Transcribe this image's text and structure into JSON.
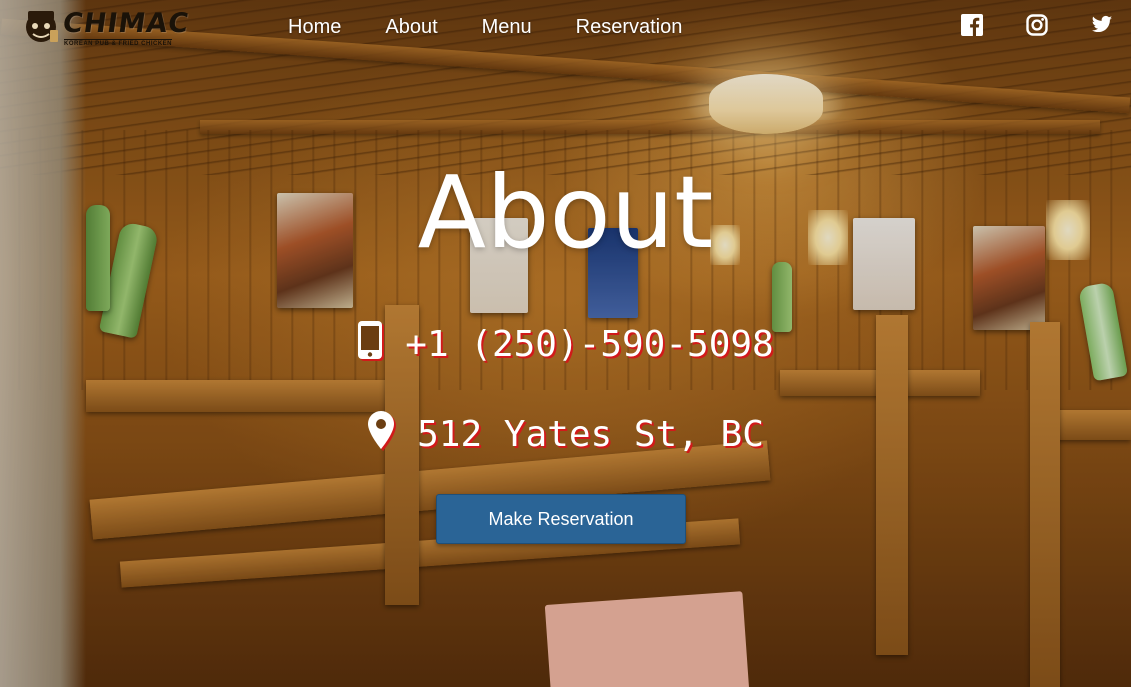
{
  "brand": {
    "name": "CHIMAC",
    "tagline": "KOREAN PUB & FRIED CHICKEN"
  },
  "nav": {
    "items": [
      {
        "label": "Home"
      },
      {
        "label": "About"
      },
      {
        "label": "Menu"
      },
      {
        "label": "Reservation"
      }
    ]
  },
  "social": {
    "icons": [
      "facebook-icon",
      "instagram-icon",
      "twitter-icon"
    ]
  },
  "hero": {
    "title": "About",
    "phone": "+1 (250)-590-5098",
    "address": "512 Yates St, BC",
    "cta_label": "Make Reservation"
  },
  "colors": {
    "cta_background": "#2a6496",
    "text_shadow_accent": "#d11a1a",
    "nav_text": "#ffffff"
  }
}
